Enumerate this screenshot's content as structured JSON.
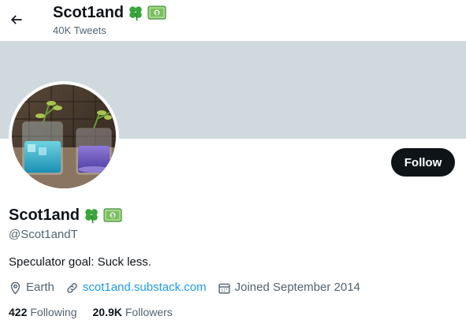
{
  "header": {
    "back_icon": "arrow-left-icon",
    "title": "Scot1and",
    "tweet_count": "40K Tweets"
  },
  "profile": {
    "display_name": "Scot1and",
    "name_emojis": [
      "four-leaf-clover-emoji",
      "dollar-banknote-emoji"
    ],
    "handle": "@Scot1andT",
    "bio": "Speculator goal: Suck less.",
    "location": "Earth",
    "website": "scot1and.substack.com",
    "joined": "Joined September 2014",
    "following_count": "422",
    "following_label": "Following",
    "followers_count": "20.9K",
    "followers_label": "Followers",
    "follow_button": "Follow"
  },
  "colors": {
    "banner": "#cfd9de",
    "text_primary": "#0f1419",
    "text_secondary": "#536471",
    "link": "#1d9bf0",
    "follow_button_bg": "#0f1419"
  }
}
